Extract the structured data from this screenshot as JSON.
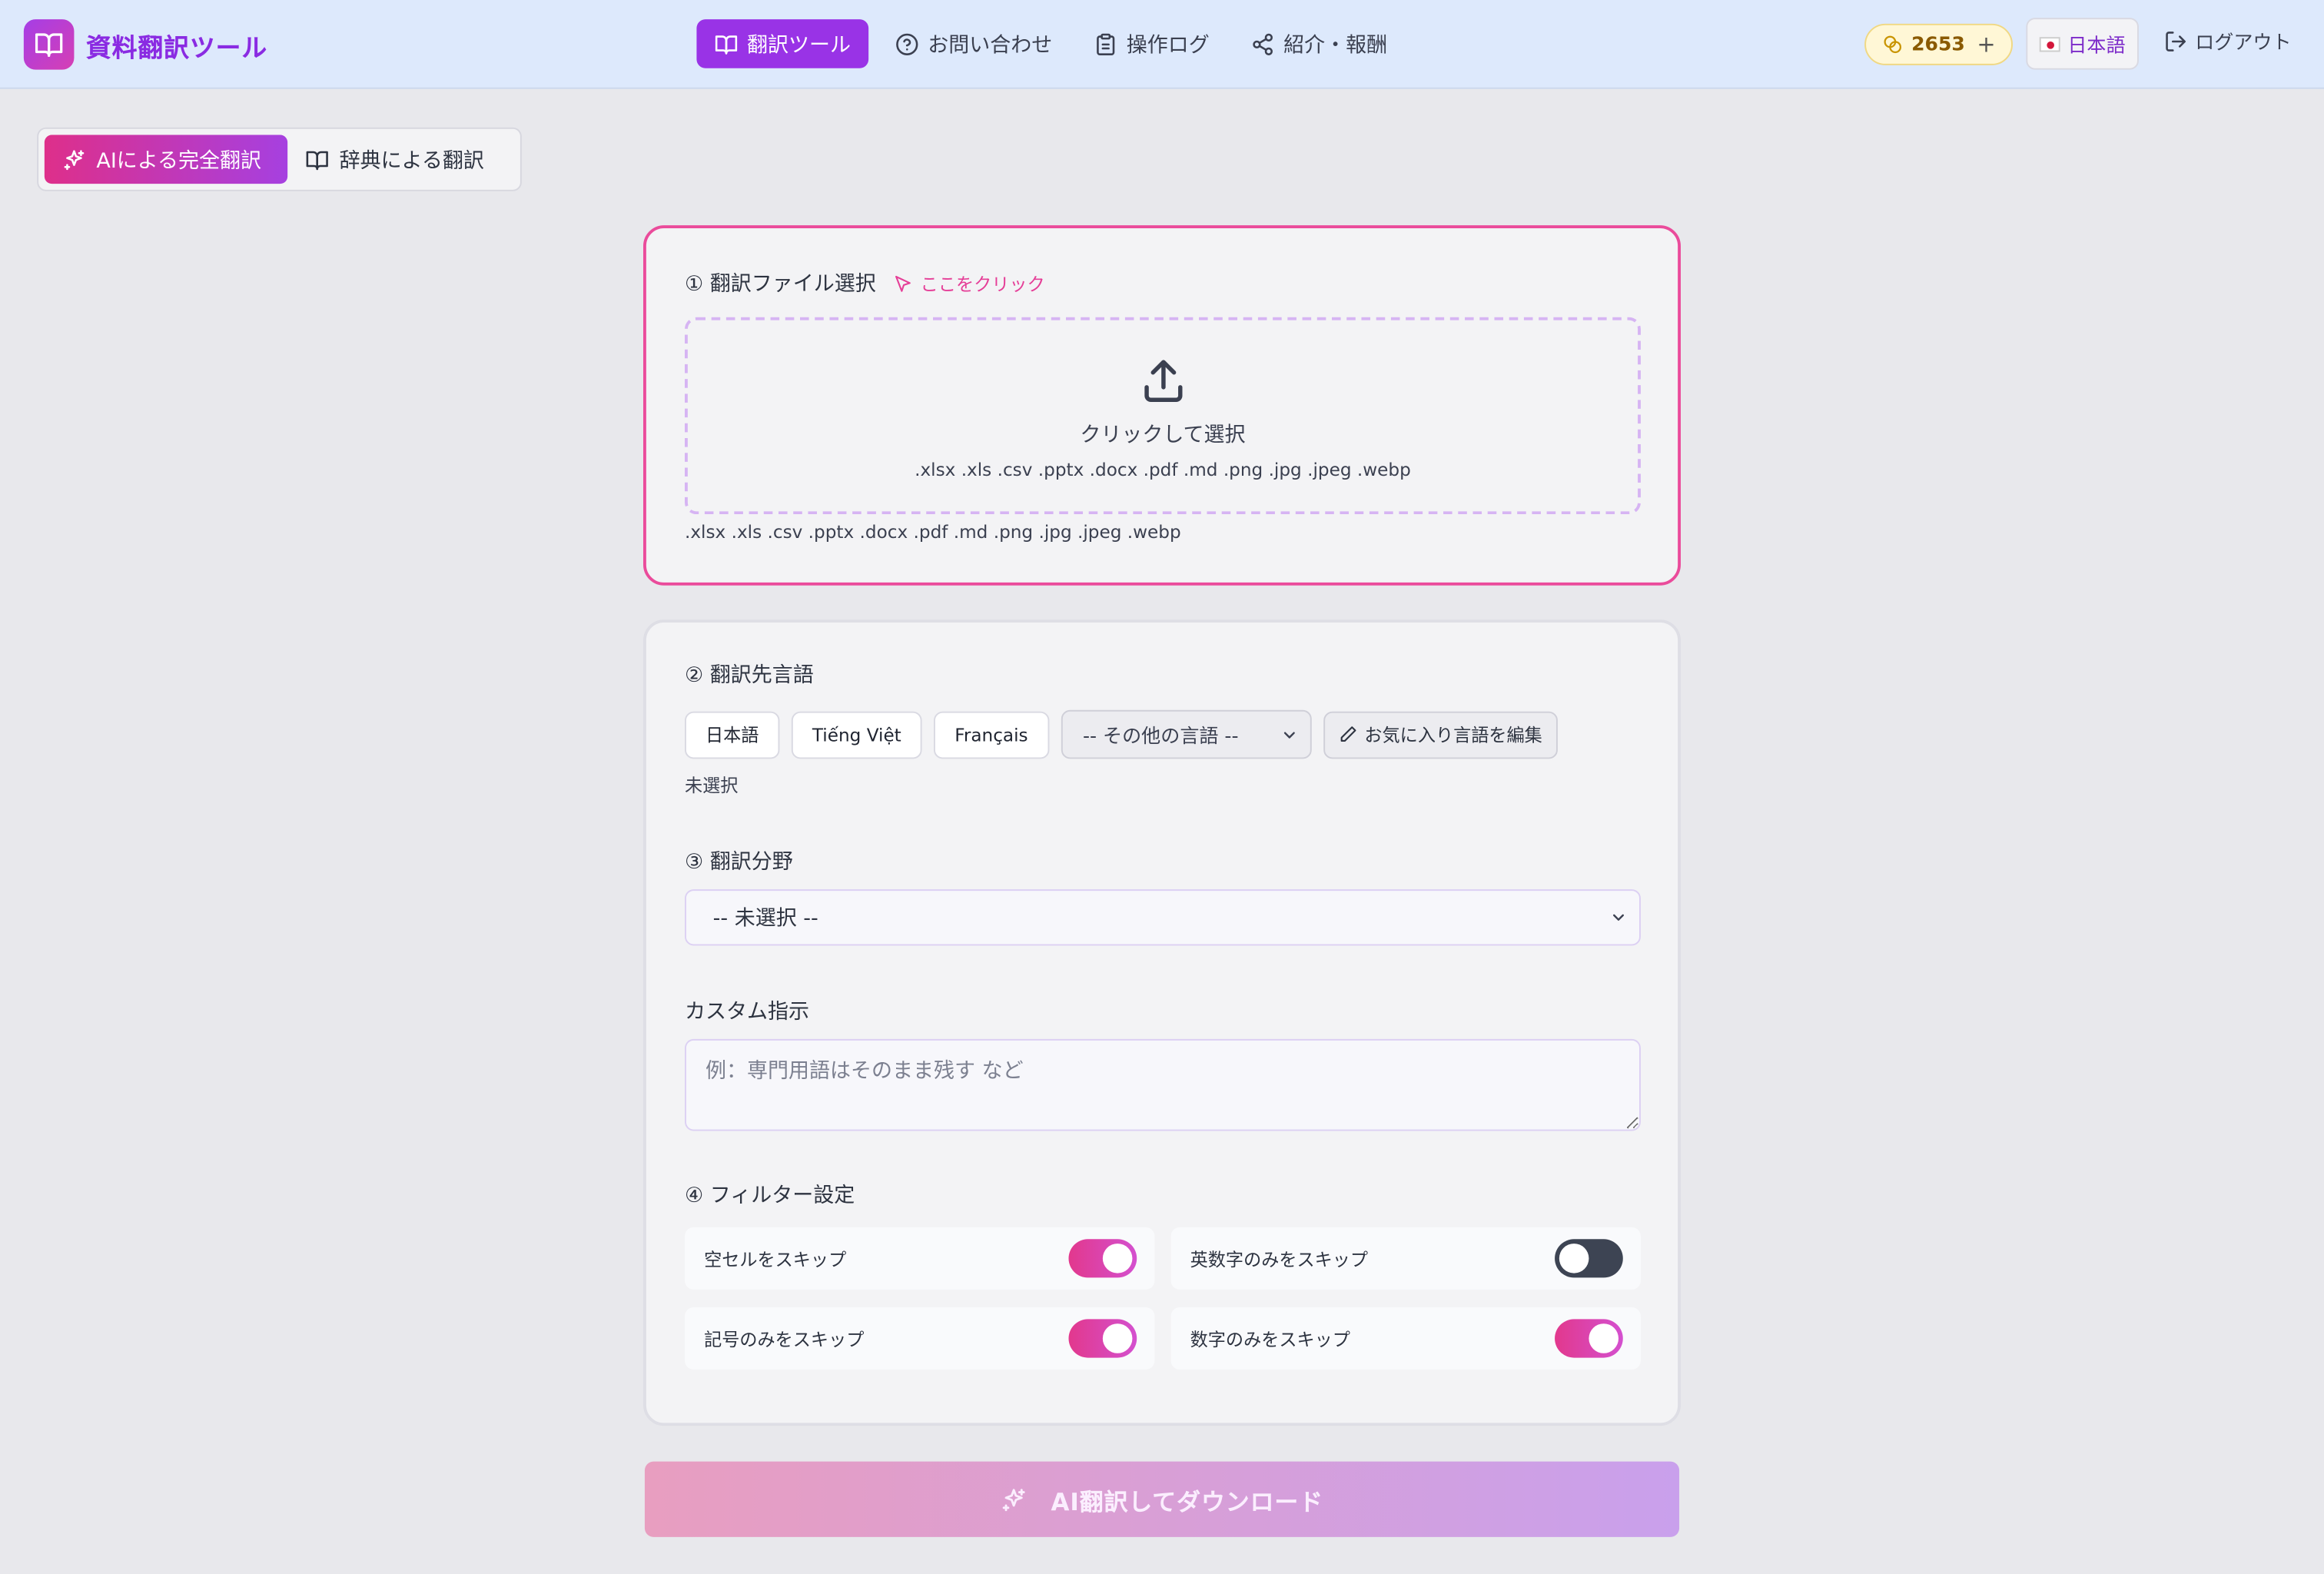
{
  "header": {
    "brand_title": "資料翻訳ツール",
    "nav": [
      {
        "label": "翻訳ツール",
        "icon": "book-icon",
        "active": true
      },
      {
        "label": "お問い合わせ",
        "icon": "help-circle-icon",
        "active": false
      },
      {
        "label": "操作ログ",
        "icon": "clipboard-icon",
        "active": false
      },
      {
        "label": "紹介・報酬",
        "icon": "share-icon",
        "active": false
      }
    ],
    "coins": "2653",
    "coins_add": "+",
    "language": "日本語",
    "logout": "ログアウト"
  },
  "mode": {
    "ai_label": "AIによる完全翻訳",
    "dict_label": "辞典による翻訳"
  },
  "upload": {
    "title": "① 翻訳ファイル選択",
    "click_hint": "ここをクリック",
    "dropzone_label": "クリックして選択",
    "formats": ".xlsx .xls .csv .pptx .docx .pdf .md .png .jpg .jpeg .webp",
    "formats_note": ".xlsx .xls .csv .pptx .docx .pdf .md .png .jpg .jpeg .webp"
  },
  "target_lang": {
    "title": "② 翻訳先言語",
    "favorites": [
      "日本語",
      "Tiếng Việt",
      "Français"
    ],
    "other_select": "-- その他の言語 --",
    "edit_favorites": "お気に入り言語を編集",
    "status": "未選択"
  },
  "field": {
    "title": "③ 翻訳分野",
    "selected": "-- 未選択 --"
  },
  "custom": {
    "title": "カスタム指示",
    "placeholder": "例：専門用語はそのまま残す など",
    "value": ""
  },
  "filters": {
    "title": "④ フィルター設定",
    "items": [
      {
        "label": "空セルをスキップ",
        "on": true
      },
      {
        "label": "英数字のみをスキップ",
        "on": false
      },
      {
        "label": "記号のみをスキップ",
        "on": true
      },
      {
        "label": "数字のみをスキップ",
        "on": true
      }
    ]
  },
  "submit": {
    "label": "AI翻訳してダウンロード"
  },
  "colors": {
    "accent_purple": "#9933e6",
    "accent_pink": "#ea4b9b",
    "toggle_off": "#3d4453"
  }
}
